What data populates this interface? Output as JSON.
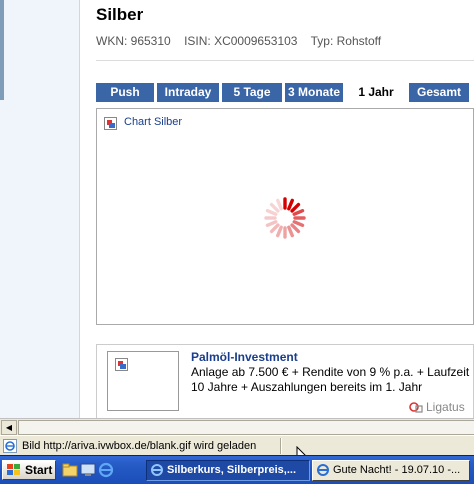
{
  "page": {
    "title": "Silber",
    "meta": {
      "wkn": "WKN: 965310",
      "isin": "ISIN: XC0009653103",
      "typ": "Typ: Rohstoff"
    }
  },
  "tabs": [
    {
      "label": "Push",
      "active": false
    },
    {
      "label": "Intraday",
      "active": false
    },
    {
      "label": "5 Tage",
      "active": false
    },
    {
      "label": "3 Monate",
      "active": false
    },
    {
      "label": "1 Jahr",
      "active": true
    },
    {
      "label": "Gesamt",
      "active": false
    }
  ],
  "chart": {
    "link_label": "Chart Silber",
    "loading_icon": "spinner-icon"
  },
  "ad": {
    "title": "Palmöl-Investment",
    "line1": "Anlage ab 7.500 € + Rendite von 9 % p.a. + Laufzeit",
    "line2": "10 Jahre + Auszahlungen bereits im 1. Jahr",
    "provider": "Ligatus"
  },
  "status_bar": {
    "text": "Bild http://ariva.ivwbox.de/blank.gif wird geladen"
  },
  "taskbar": {
    "start_label": "Start",
    "tasks": [
      {
        "label": "Silberkurs, Silberpreis,...",
        "active": true
      },
      {
        "label": "Gute Nacht! - 19.07.10 -...",
        "active": false
      }
    ]
  },
  "colors": {
    "tab_blue": "#3a66a7",
    "link_blue": "#1a3e8c",
    "spinner_red": "#d40000",
    "taskbar_blue": "#2458c3"
  }
}
